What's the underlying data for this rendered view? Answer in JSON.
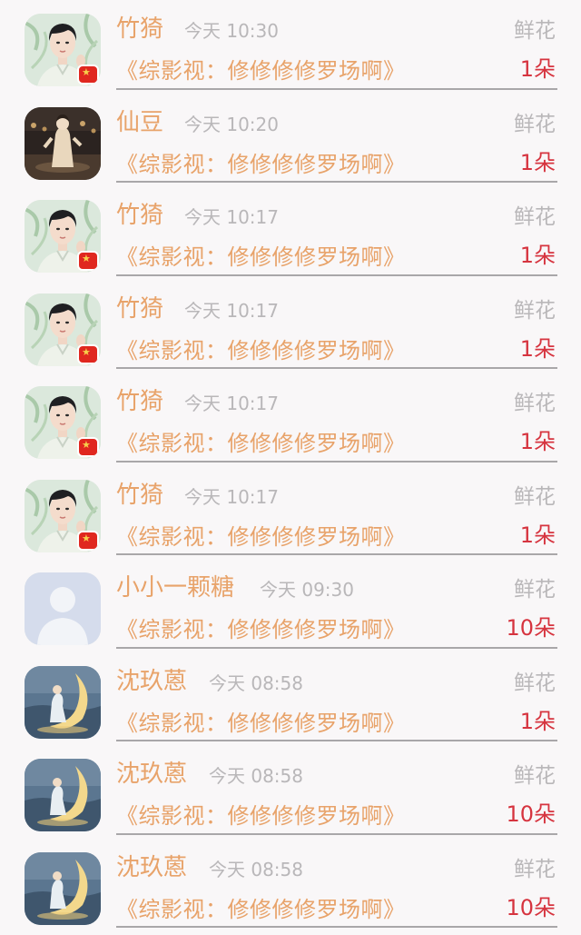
{
  "records": [
    {
      "name": "竹猗",
      "time": "今天 10:30",
      "gift": "鲜花",
      "work": "《综影视：修修修修罗场啊》",
      "count": "1朵",
      "avatar": "bamboo-boy",
      "badge": true
    },
    {
      "name": "仙豆",
      "time": "今天 10:20",
      "gift": "鲜花",
      "work": "《综影视：修修修修罗场啊》",
      "count": "1朵",
      "avatar": "stage",
      "badge": false
    },
    {
      "name": "竹猗",
      "time": "今天 10:17",
      "gift": "鲜花",
      "work": "《综影视：修修修修罗场啊》",
      "count": "1朵",
      "avatar": "bamboo-boy",
      "badge": true
    },
    {
      "name": "竹猗",
      "time": "今天 10:17",
      "gift": "鲜花",
      "work": "《综影视：修修修修罗场啊》",
      "count": "1朵",
      "avatar": "bamboo-boy",
      "badge": true
    },
    {
      "name": "竹猗",
      "time": "今天 10:17",
      "gift": "鲜花",
      "work": "《综影视：修修修修罗场啊》",
      "count": "1朵",
      "avatar": "bamboo-boy",
      "badge": true
    },
    {
      "name": "竹猗",
      "time": "今天 10:17",
      "gift": "鲜花",
      "work": "《综影视：修修修修罗场啊》",
      "count": "1朵",
      "avatar": "bamboo-boy",
      "badge": true
    },
    {
      "name": "小小一颗糖",
      "time": "今天 09:30",
      "gift": "鲜花",
      "work": "《综影视：修修修修罗场啊》",
      "count": "10朵",
      "avatar": "default-person",
      "badge": false
    },
    {
      "name": "沈玖蒽",
      "time": "今天 08:58",
      "gift": "鲜花",
      "work": "《综影视：修修修修罗场啊》",
      "count": "1朵",
      "avatar": "moon-girl",
      "badge": false
    },
    {
      "name": "沈玖蒽",
      "time": "今天 08:58",
      "gift": "鲜花",
      "work": "《综影视：修修修修罗场啊》",
      "count": "10朵",
      "avatar": "moon-girl",
      "badge": false
    },
    {
      "name": "沈玖蒽",
      "time": "今天 08:58",
      "gift": "鲜花",
      "work": "《综影视：修修修修罗场啊》",
      "count": "10朵",
      "avatar": "moon-girl",
      "badge": false
    }
  ],
  "colors": {
    "name": "#e8a36a",
    "muted": "#b9b7b9",
    "count": "#d6343f",
    "background": "#f9f7f8"
  }
}
